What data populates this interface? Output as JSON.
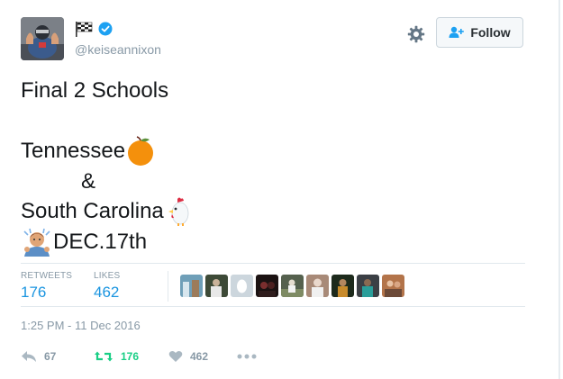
{
  "header": {
    "handle": "@keiseannixon",
    "follow_label": "Follow",
    "verified_color": "#1da1f2"
  },
  "tweet": {
    "lines": [
      "Final 2 Schools",
      "Tennessee",
      "&",
      "South Carolina",
      "DEC.17th"
    ],
    "emojis": [
      "orange-emoji",
      "rooster-emoji",
      "person-gesturing-emoji"
    ]
  },
  "stats": {
    "retweets_label": "RETWEETS",
    "retweets_value": "176",
    "likes_label": "LIKES",
    "likes_value": "462",
    "liker_avatar_count": 9
  },
  "timestamp": "1:25 PM - 11 Dec 2016",
  "actions": {
    "reply_count": "67",
    "retweet_count": "176",
    "like_count": "462"
  },
  "colors": {
    "link_blue": "#1b95e0",
    "retweet_green": "#19cf86",
    "muted_gray": "#8899a6"
  }
}
